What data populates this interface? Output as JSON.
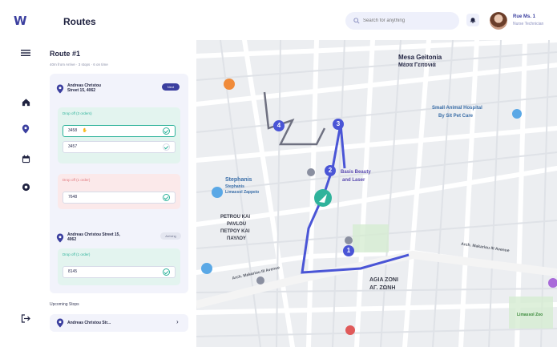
{
  "app": {
    "logo": "W",
    "title": "Routes"
  },
  "header": {
    "search_placeholder": "Search for anything",
    "user_name": "Rue Ms. 1",
    "user_role": "Nurse Technician"
  },
  "route": {
    "title": "Route #1",
    "meta": "40m from Arrive · 3 stops · 6 on time",
    "stop1": {
      "address_line1": "Andreas Christou",
      "address_line2": "Street 15, 4062",
      "badge": "Next",
      "pickup_label": "Drop off (3 orders)",
      "pickup_fields": [
        "3458",
        "3457"
      ],
      "dropoff_label": "Drop off (1 order)",
      "dropoff_fields": [
        "7648"
      ]
    },
    "stop2": {
      "address_line1": "Andreas Christou Street 15,",
      "address_line2": "4062",
      "badge": "Arriving",
      "pickup_label": "Drop off (1 order)",
      "pickup_fields": [
        "8145"
      ]
    },
    "upcoming_label": "Upcoming Stops",
    "upcoming_item": "Andreas Christou Str..."
  },
  "map": {
    "labels": {
      "area1": "Mesa Geitonia",
      "area1_gr": "Μέσα Γειτονιά",
      "vet": "Small Animal Hospital",
      "vet2": "By Sit Pet Care",
      "stephanis": "Stephanis",
      "stephanis2": "Stephanis",
      "stephanis3": "Limassol Zappeio",
      "petrou1": "PETROU KAI",
      "petrou2": "PAVLOU",
      "petrou3": "ΠΕΤΡΟΥ ΚΑΙ",
      "petrou4": "ΠΑΥΛΟΥ",
      "beauty1": "Basis Beauty",
      "beauty2": "and Laser",
      "agia1": "AGIA ZONI",
      "agia2": "ΑΓ. ΖΩΝΗ",
      "makarios": "Arch. Makariou III Avenue",
      "makarios2": "Arch. Makariou III Avenue",
      "makarios3": "Arch. Makariou III Avenue",
      "gnosi": "Limassol Zoo",
      "gnosi2": "Limassol Zoo"
    },
    "stops": [
      "1",
      "2",
      "3",
      "4"
    ],
    "route_color": "#4a55d6",
    "stop_color": "#4a55d6",
    "accent_green": "#2fb39b"
  }
}
